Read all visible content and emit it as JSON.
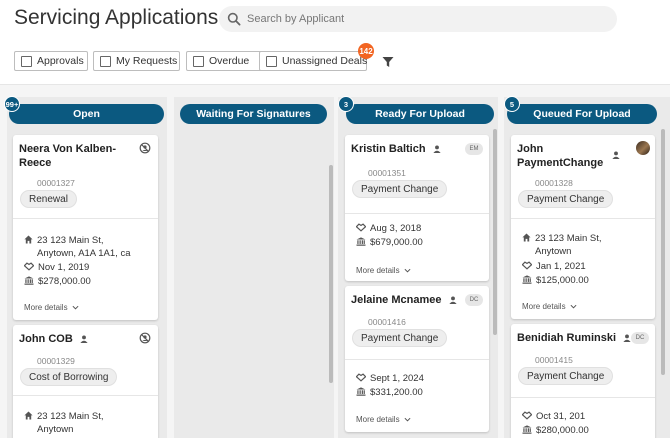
{
  "page": {
    "title": "Servicing Applications"
  },
  "search": {
    "placeholder": "Search by Applicant",
    "icon": "search-icon"
  },
  "filters": [
    {
      "label": "Approvals",
      "checked": false
    },
    {
      "label": "My Requests",
      "checked": false
    },
    {
      "label": "Overdue",
      "checked": false
    },
    {
      "label": "Unassigned Deals",
      "checked": false,
      "badge": "142"
    }
  ],
  "filter_icon": "filter-icon",
  "colors": {
    "header": "#0b5980",
    "badge": "#f26522",
    "column_bg": "#eaeaea"
  },
  "columns": [
    {
      "title": "Open",
      "count": "99+",
      "cards": [
        {
          "name": "Neera Von Kalben-Reece",
          "id": "00001327",
          "tag": "Renewal",
          "assignee": "unassigned",
          "address_line1": "23 123 Main St,",
          "address_line2": "Anytown, A1A 1A1, ca",
          "date": "Nov 1, 2019",
          "amount": "$278,000.00",
          "more": "More details"
        },
        {
          "name": "John COB",
          "id": "00001329",
          "tag": "Cost of Borrowing",
          "assignee": "unassigned",
          "address_line1": "23 123 Main St,",
          "address_line2": "Anytown"
        }
      ]
    },
    {
      "title": "Waiting For Signatures",
      "count": "",
      "cards": []
    },
    {
      "title": "Ready For Upload",
      "count": "3",
      "cards": [
        {
          "name": "Kristin Baltich",
          "id": "00001351",
          "tag": "Payment Change",
          "initials": "EM",
          "date": "Aug 3, 2018",
          "amount": "$679,000.00",
          "more": "More details"
        },
        {
          "name": "Jelaine Mcnamee",
          "id": "00001416",
          "tag": "Payment Change",
          "initials": "DC",
          "date": "Sept 1, 2024",
          "amount": "$331,200.00",
          "more": "More details"
        }
      ]
    },
    {
      "title": "Queued For Upload",
      "count": "5",
      "cards": [
        {
          "name_line1": "John",
          "name_line2": "PaymentChange",
          "id": "00001328",
          "tag": "Payment Change",
          "address_line1": "23 123 Main St,",
          "address_line2": "Anytown",
          "date": "Jan 1, 2021",
          "amount": "$125,000.00",
          "more": "More details"
        },
        {
          "name": "Benidiah Ruminski",
          "id": "00001415",
          "tag": "Payment Change",
          "initials": "DC",
          "date": "Oct 31, 201",
          "amount": "$280,000.00"
        }
      ]
    }
  ]
}
